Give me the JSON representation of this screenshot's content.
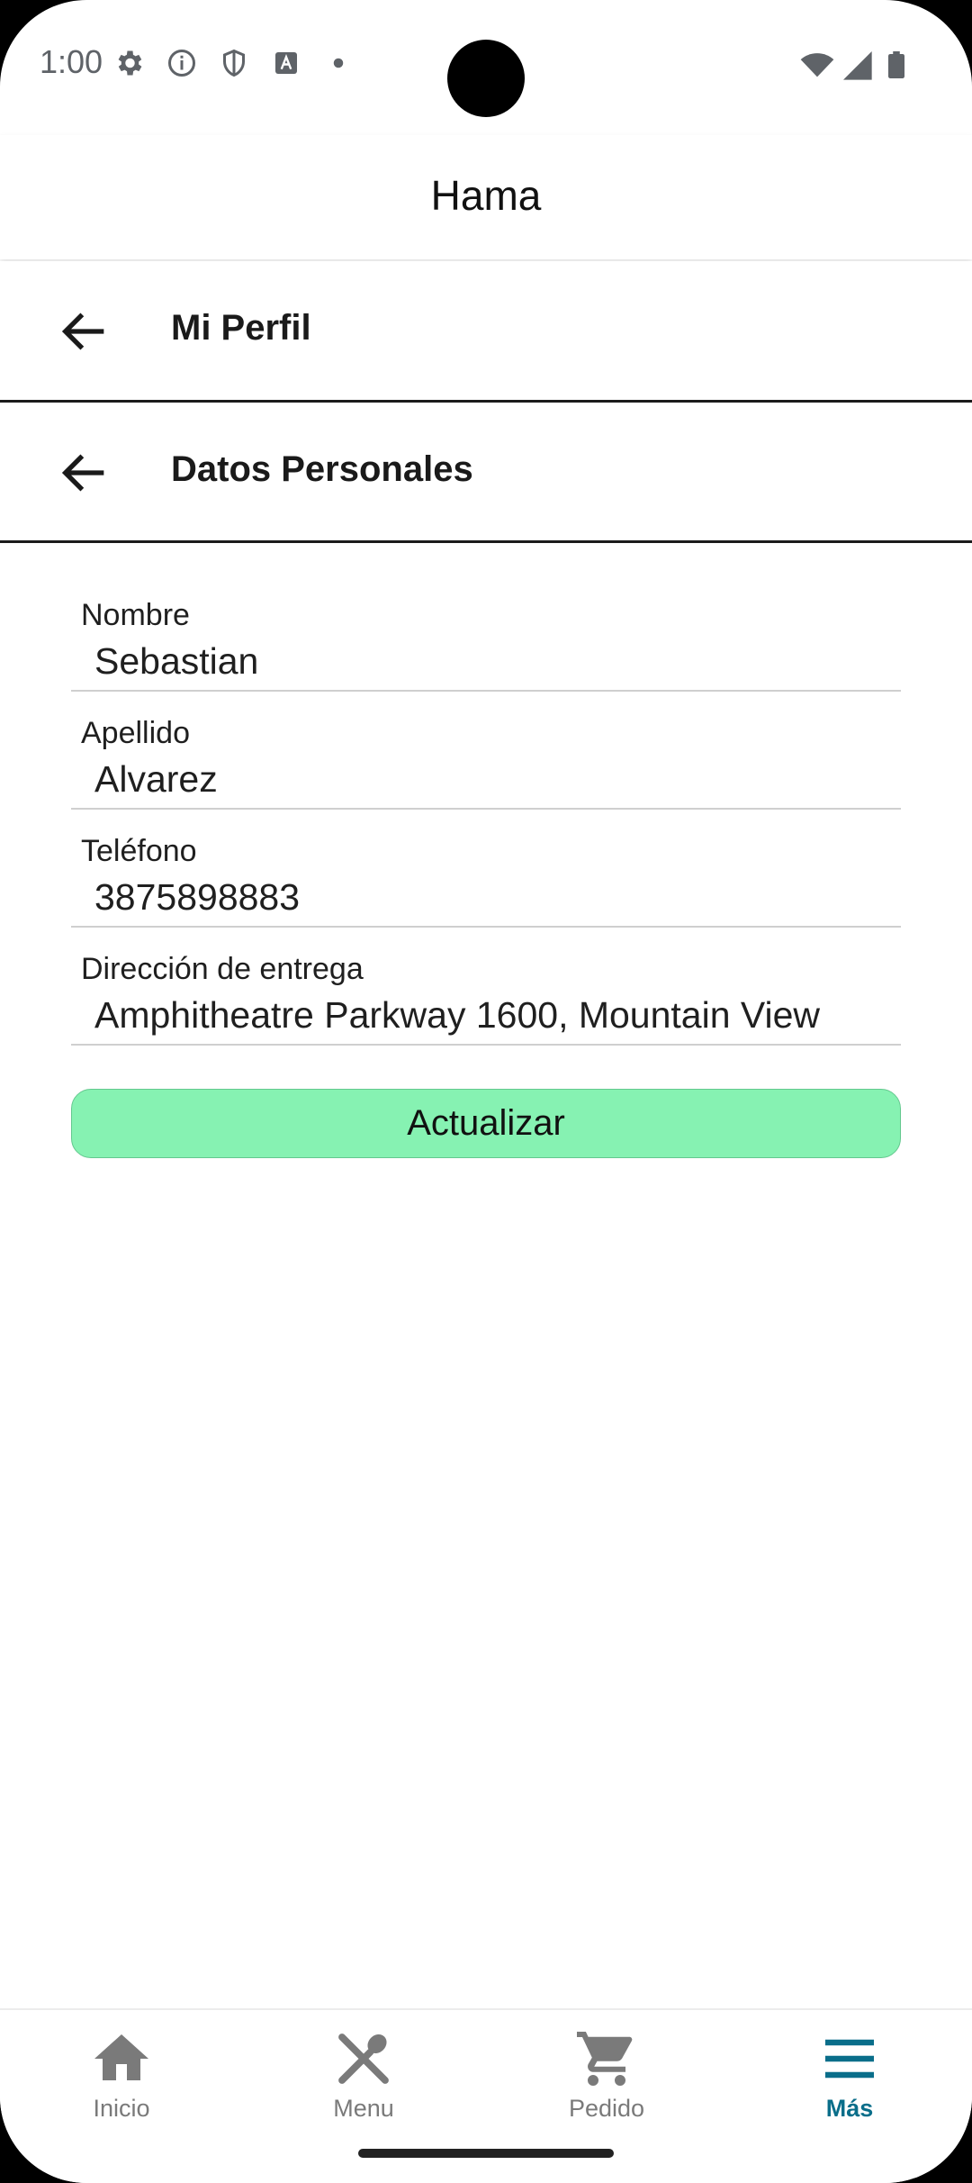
{
  "status_bar": {
    "time": "1:00",
    "left_icons": [
      "gear-icon",
      "info-icon",
      "shield-icon",
      "font-icon",
      "dot-icon"
    ],
    "right_icons": [
      "wifi-icon",
      "signal-icon",
      "battery-icon"
    ]
  },
  "app_bar": {
    "title": "Hama"
  },
  "profile_header": {
    "label": "Mi Perfil",
    "icon": "back-arrow-icon"
  },
  "personal_header": {
    "label": "Datos Personales",
    "icon": "back-arrow-icon"
  },
  "form": {
    "nombre": {
      "label": "Nombre",
      "value": "Sebastian"
    },
    "apellido": {
      "label": "Apellido",
      "value": "Alvarez"
    },
    "telefono": {
      "label": "Teléfono",
      "value": "3875898883"
    },
    "direccion": {
      "label": "Dirección de entrega",
      "value": "Amphitheatre Parkway 1600, Mountain View"
    },
    "submit_label": "Actualizar",
    "button_color": "#86f2b2"
  },
  "bottom_nav": {
    "active_color": "#0a6e8a",
    "items": [
      {
        "label": "Inicio",
        "icon": "home-icon"
      },
      {
        "label": "Menu",
        "icon": "utensils-icon"
      },
      {
        "label": "Pedido",
        "icon": "cart-icon"
      },
      {
        "label": "Más",
        "icon": "menu-icon"
      }
    ],
    "active_index": 3
  }
}
